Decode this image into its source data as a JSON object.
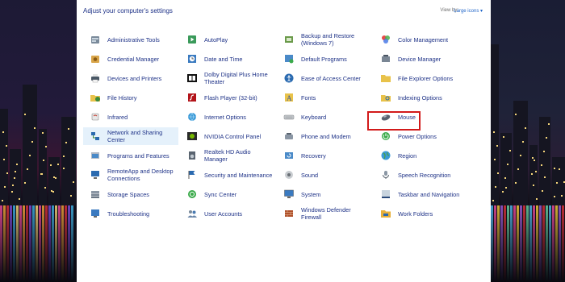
{
  "header": {
    "title": "Adjust your computer's settings",
    "view_by_label": "View by:",
    "view_by_value": "Large icons ▾"
  },
  "columns": [
    [
      {
        "name": "administrative-tools",
        "label": "Administrative Tools",
        "icon": "tools-icon"
      },
      {
        "name": "credential-manager",
        "label": "Credential Manager",
        "icon": "vault-icon"
      },
      {
        "name": "devices-and-printers",
        "label": "Devices and Printers",
        "icon": "printer-icon"
      },
      {
        "name": "file-history",
        "label": "File History",
        "icon": "folder-clock-icon"
      },
      {
        "name": "infrared",
        "label": "Infrared",
        "icon": "infrared-icon"
      },
      {
        "name": "network-and-sharing-center",
        "label": "Network and Sharing Center",
        "icon": "network-icon",
        "selected": true
      },
      {
        "name": "programs-and-features",
        "label": "Programs and Features",
        "icon": "programs-icon"
      },
      {
        "name": "remoteapp-and-desktop-connections",
        "label": "RemoteApp and Desktop Connections",
        "icon": "remote-desktop-icon"
      },
      {
        "name": "storage-spaces",
        "label": "Storage Spaces",
        "icon": "storage-icon"
      },
      {
        "name": "troubleshooting",
        "label": "Troubleshooting",
        "icon": "troubleshoot-icon"
      }
    ],
    [
      {
        "name": "autoplay",
        "label": "AutoPlay",
        "icon": "autoplay-icon"
      },
      {
        "name": "date-and-time",
        "label": "Date and Time",
        "icon": "clock-icon"
      },
      {
        "name": "dolby-digital-plus-home-theater",
        "label": "Dolby Digital Plus Home Theater",
        "icon": "dolby-icon"
      },
      {
        "name": "flash-player",
        "label": "Flash Player (32-bit)",
        "icon": "flash-icon"
      },
      {
        "name": "internet-options",
        "label": "Internet Options",
        "icon": "globe-icon"
      },
      {
        "name": "nvidia-control-panel",
        "label": "NVIDIA Control Panel",
        "icon": "nvidia-icon"
      },
      {
        "name": "realtek-hd-audio-manager",
        "label": "Realtek HD Audio Manager",
        "icon": "speaker-icon"
      },
      {
        "name": "security-and-maintenance",
        "label": "Security and Maintenance",
        "icon": "flag-icon"
      },
      {
        "name": "sync-center",
        "label": "Sync Center",
        "icon": "sync-icon"
      },
      {
        "name": "user-accounts",
        "label": "User Accounts",
        "icon": "users-icon"
      }
    ],
    [
      {
        "name": "backup-and-restore",
        "label": "Backup and Restore (Windows 7)",
        "icon": "backup-icon"
      },
      {
        "name": "default-programs",
        "label": "Default Programs",
        "icon": "default-programs-icon"
      },
      {
        "name": "ease-of-access-center",
        "label": "Ease of Access Center",
        "icon": "accessibility-icon"
      },
      {
        "name": "fonts",
        "label": "Fonts",
        "icon": "font-icon"
      },
      {
        "name": "keyboard",
        "label": "Keyboard",
        "icon": "keyboard-icon"
      },
      {
        "name": "phone-and-modem",
        "label": "Phone and Modem",
        "icon": "phone-icon"
      },
      {
        "name": "recovery",
        "label": "Recovery",
        "icon": "recovery-icon"
      },
      {
        "name": "sound",
        "label": "Sound",
        "icon": "sound-icon"
      },
      {
        "name": "system",
        "label": "System",
        "icon": "monitor-icon"
      },
      {
        "name": "windows-defender-firewall",
        "label": "Windows Defender Firewall",
        "icon": "firewall-icon"
      }
    ],
    [
      {
        "name": "color-management",
        "label": "Color Management",
        "icon": "color-icon"
      },
      {
        "name": "device-manager",
        "label": "Device Manager",
        "icon": "device-manager-icon"
      },
      {
        "name": "file-explorer-options",
        "label": "File Explorer Options",
        "icon": "folder-icon"
      },
      {
        "name": "indexing-options",
        "label": "Indexing Options",
        "icon": "indexing-icon"
      },
      {
        "name": "mouse",
        "label": "Mouse",
        "icon": "mouse-icon",
        "highlighted": true
      },
      {
        "name": "power-options",
        "label": "Power Options",
        "icon": "power-icon"
      },
      {
        "name": "region",
        "label": "Region",
        "icon": "region-icon"
      },
      {
        "name": "speech-recognition",
        "label": "Speech Recognition",
        "icon": "microphone-icon"
      },
      {
        "name": "taskbar-and-navigation",
        "label": "Taskbar and Navigation",
        "icon": "taskbar-icon"
      },
      {
        "name": "work-folders",
        "label": "Work Folders",
        "icon": "work-folders-icon"
      }
    ]
  ],
  "colors": {
    "link": "#1e3287",
    "selection_bg": "#e5f1fb",
    "highlight_border": "#d21a1a"
  }
}
